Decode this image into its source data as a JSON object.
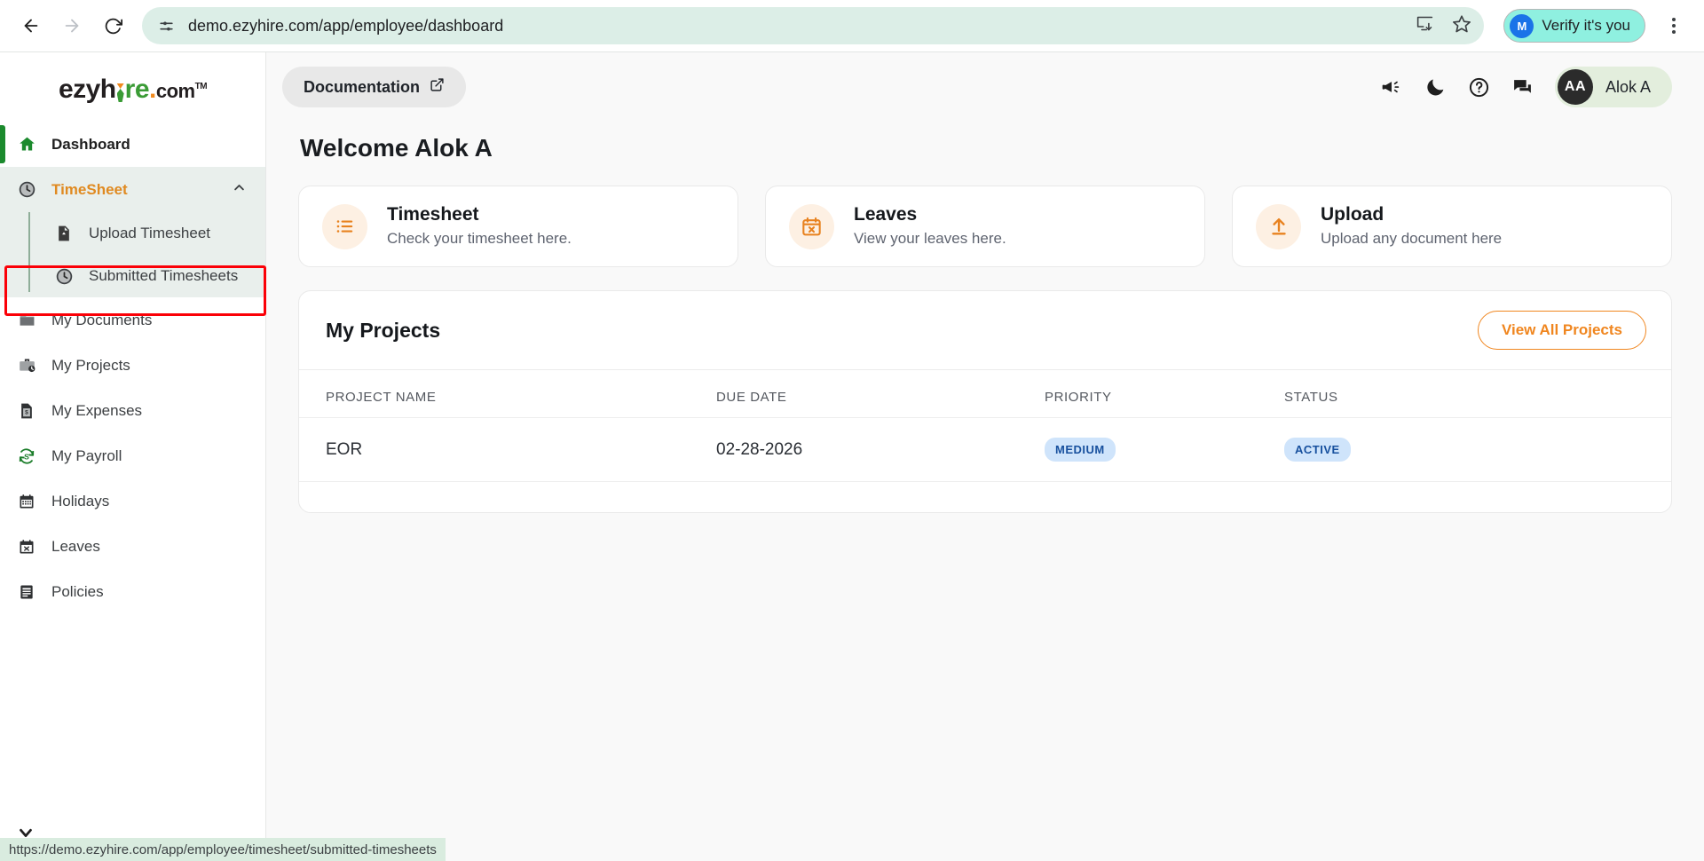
{
  "browser": {
    "back_icon": "back-arrow-icon",
    "forward_icon": "forward-arrow-icon",
    "reload_icon": "reload-icon",
    "site_info_icon": "site-settings-icon",
    "url": "demo.ezyhire.com/app/employee/dashboard",
    "install_icon": "install-app-icon",
    "bookmark_icon": "star-icon",
    "verify_label": "Verify it's you",
    "verify_avatar": "M",
    "menu_icon": "three-dot-menu-icon"
  },
  "sidebar": {
    "logo": {
      "part1": "ezyh",
      "part2": "re",
      "dot": ".",
      "com": "com",
      "tm": "TM"
    },
    "items": [
      {
        "label": "Dashboard",
        "icon": "home-icon"
      },
      {
        "label": "My Documents",
        "icon": "folder-icon"
      },
      {
        "label": "My Projects",
        "icon": "briefcase-clock-icon"
      },
      {
        "label": "My Expenses",
        "icon": "receipt-dollar-icon"
      },
      {
        "label": "My Payroll",
        "icon": "money-refresh-icon"
      },
      {
        "label": "Holidays",
        "icon": "calendar-icon"
      },
      {
        "label": "Leaves",
        "icon": "calendar-x-icon"
      },
      {
        "label": "Policies",
        "icon": "document-lines-icon"
      }
    ],
    "group": {
      "label": "TimeSheet",
      "icon": "clock-icon",
      "caret": "chevron-up-icon",
      "children": [
        {
          "label": "Upload Timesheet",
          "icon": "file-upload-icon"
        },
        {
          "label": "Submitted Timesheets",
          "icon": "clock-icon"
        }
      ]
    },
    "collapse_icon": "chevron-down-icon"
  },
  "topbar": {
    "documentation_label": "Documentation",
    "external_link_icon": "external-link-icon",
    "icons": [
      "megaphone-icon",
      "moon-icon",
      "help-circle-icon",
      "chat-icon"
    ],
    "user": {
      "initials": "AA",
      "name": "Alok A"
    }
  },
  "main": {
    "welcome": "Welcome Alok A",
    "cards": [
      {
        "title": "Timesheet",
        "subtitle": "Check your timesheet here.",
        "icon": "list-icon"
      },
      {
        "title": "Leaves",
        "subtitle": "View your leaves here.",
        "icon": "calendar-x-icon"
      },
      {
        "title": "Upload",
        "subtitle": "Upload any document here",
        "icon": "upload-arrow-icon"
      }
    ],
    "projects_panel": {
      "title": "My Projects",
      "view_all_label": "View All Projects",
      "columns": [
        "PROJECT NAME",
        "DUE DATE",
        "PRIORITY",
        "STATUS"
      ],
      "rows": [
        {
          "name": "EOR",
          "due_date": "02-28-2026",
          "priority": "MEDIUM",
          "status": "ACTIVE"
        }
      ]
    }
  },
  "statusbar": {
    "url": "https://demo.ezyhire.com/app/employee/timesheet/submitted-timesheets"
  },
  "colors": {
    "accent_orange": "#f0861f",
    "accent_green": "#1b8a2d",
    "badge_bg": "#cfe4fb",
    "badge_text": "#17509e",
    "highlight_red": "#fb0007"
  }
}
